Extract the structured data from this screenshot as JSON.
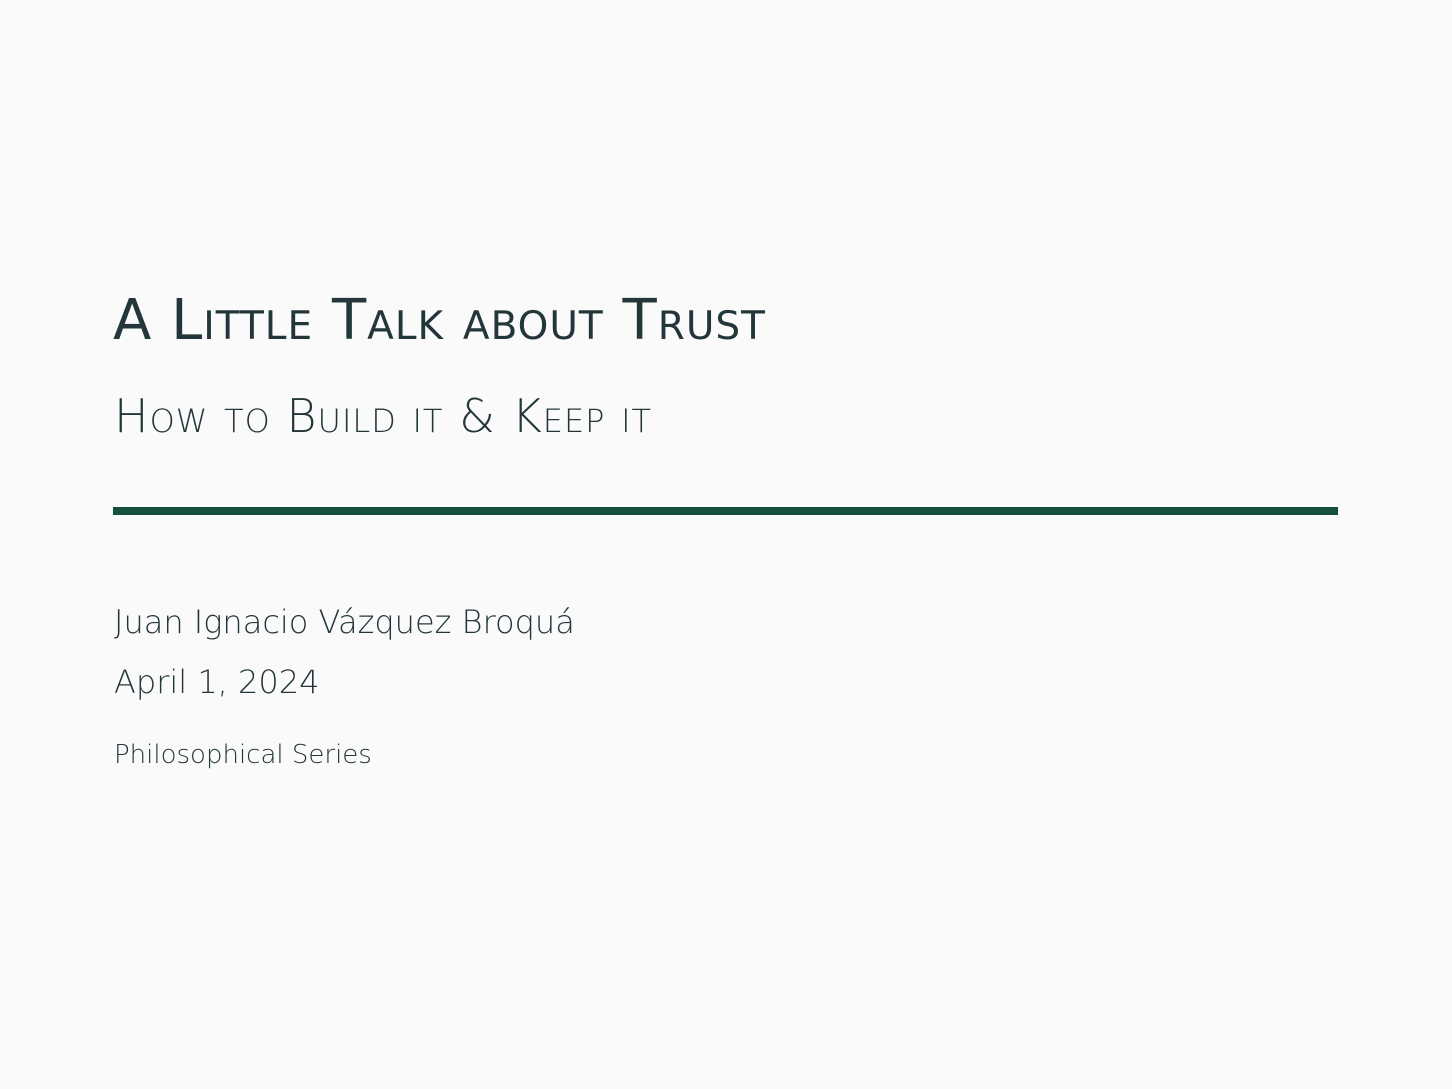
{
  "title": "A Little Talk about Trust",
  "subtitle": "How to Build it & Keep it",
  "author": "Juan Ignacio Vázquez Broquá",
  "date": "April 1, 2024",
  "institute": "Philosophical Series",
  "colors": {
    "background": "#fafafa",
    "text": "#23373b",
    "accent_rule": "#14503c"
  }
}
